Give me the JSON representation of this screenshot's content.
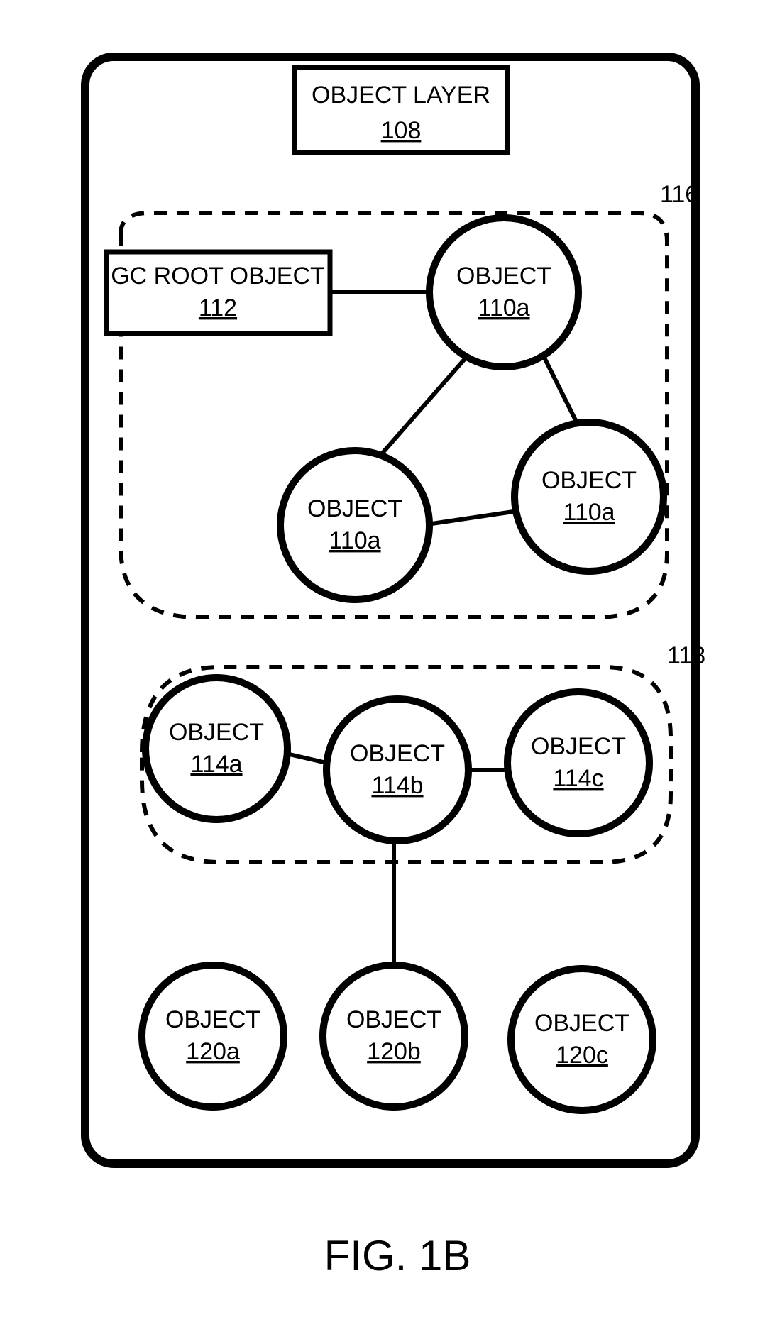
{
  "figure_label": "FIG. 1B",
  "layer_title": "OBJECT LAYER",
  "layer_ref": "108",
  "root": {
    "title": "GC ROOT OBJECT",
    "ref": "112"
  },
  "groups": {
    "top_ref": "116",
    "mid_ref": "118"
  },
  "objects": {
    "o110a_1": {
      "title": "OBJECT",
      "ref": "110a"
    },
    "o110a_2": {
      "title": "OBJECT",
      "ref": "110a"
    },
    "o110a_3": {
      "title": "OBJECT",
      "ref": "110a"
    },
    "o114a": {
      "title": "OBJECT",
      "ref": "114a"
    },
    "o114b": {
      "title": "OBJECT",
      "ref": "114b"
    },
    "o114c": {
      "title": "OBJECT",
      "ref": "114c"
    },
    "o120a": {
      "title": "OBJECT",
      "ref": "120a"
    },
    "o120b": {
      "title": "OBJECT",
      "ref": "120b"
    },
    "o120c": {
      "title": "OBJECT",
      "ref": "120c"
    }
  },
  "edges": [
    [
      "root",
      "o110a_1"
    ],
    [
      "o110a_1",
      "o110a_2"
    ],
    [
      "o110a_1",
      "o110a_3"
    ],
    [
      "o110a_2",
      "o110a_3"
    ],
    [
      "o114a",
      "o114b"
    ],
    [
      "o114b",
      "o114c"
    ],
    [
      "o114b",
      "o120b"
    ]
  ]
}
